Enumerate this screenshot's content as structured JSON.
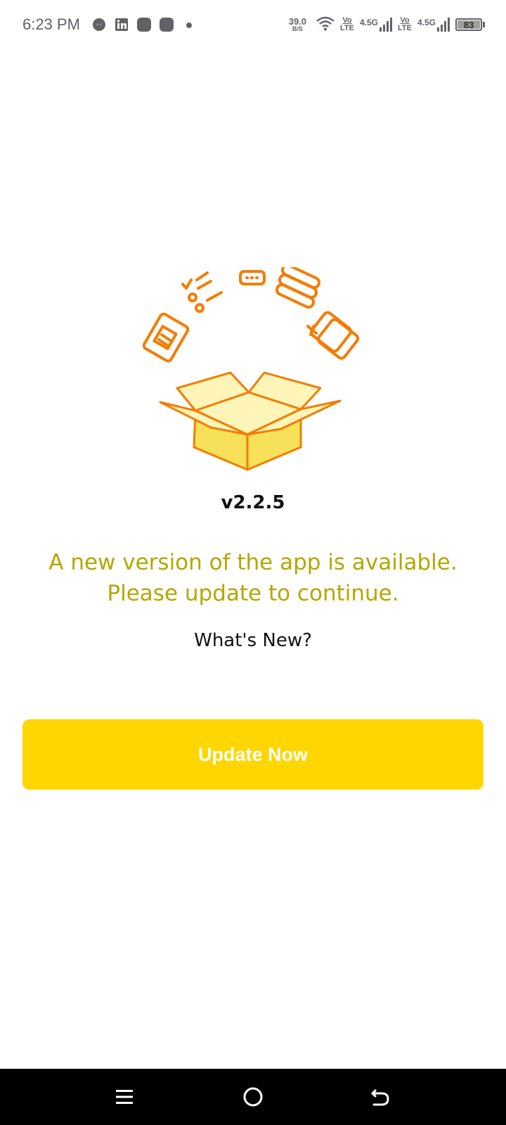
{
  "status_bar": {
    "time": "6:23 PM",
    "net_speed_value": "39.0",
    "net_speed_unit": "B/S",
    "volte1_top": "Vo",
    "volte1_bottom": "LTE",
    "signal1_label": "4.5G",
    "volte2_top": "Vo",
    "volte2_bottom": "LTE",
    "signal2_label": "4.5G",
    "battery_level": "83",
    "notification_icons": [
      "messenger-icon",
      "linkedin-icon",
      "app-icon",
      "app-icon",
      "more-dot-icon"
    ]
  },
  "update": {
    "version": "v2.2.5",
    "message_line1": "A new version of the app is available.",
    "message_line2": "Please update to continue.",
    "whats_new": "What's New?",
    "button_label": "Update Now"
  },
  "colors": {
    "accent": "#ffd600",
    "message": "#b5a600",
    "illustration_stroke": "#f57c00",
    "box_light": "#fff5b8",
    "box_mid": "#f7e15a"
  },
  "nav_bar": {
    "icons": [
      "menu-icon",
      "home-icon",
      "back-icon"
    ]
  }
}
